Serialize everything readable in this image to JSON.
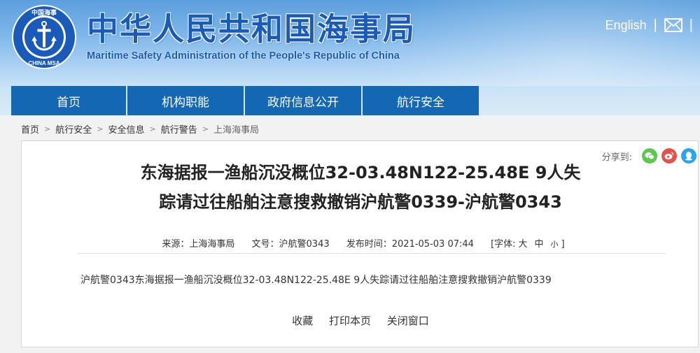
{
  "header": {
    "logo_text_top": "中国海事",
    "logo_text_bottom": "CHINA MSA",
    "title": "中华人民共和国海事局",
    "subtitle": "Maritime Safety Administration of the People's Republic of China",
    "english_link": "English",
    "separator": "|",
    "mail_icon": "mail-icon"
  },
  "nav": {
    "items": [
      {
        "label": "首页"
      },
      {
        "label": "机构职能"
      },
      {
        "label": "政府信息公开"
      },
      {
        "label": "航行安全"
      }
    ],
    "color": "#1467b3"
  },
  "breadcrumb": {
    "items": [
      "首页",
      "航行安全",
      "安全信息",
      "航行警告",
      "上海海事局"
    ],
    "separator": ">"
  },
  "share": {
    "label": "分享到:",
    "buttons": [
      {
        "name": "wechat-icon",
        "color": "#5cc84f"
      },
      {
        "name": "weibo-icon",
        "color": "#e2534d"
      },
      {
        "name": "qq-icon",
        "color": "#2ea4e8"
      }
    ]
  },
  "article": {
    "title_line1": "东海据报一渔船沉没概位32-03.48N122-25.48E 9人失",
    "title_line2": "踪请过往船舶注意搜救撤销沪航警0339-沪航警0343",
    "source": "来源：上海海事局",
    "doc_no": "文号：沪航警0343",
    "publish_time": "发布时间：2021-05-03 07:44",
    "font_label": "[字体:",
    "font_large": "大",
    "font_medium": "中",
    "font_small": "小",
    "font_close": "]",
    "body": "沪航警0343东海据报一渔船沉没概位32-03.48N122-25.48E 9人失踪请过往船舶注意搜救撤销沪航警0339"
  },
  "actions": {
    "favorite": "收藏",
    "print": "打印本页",
    "close": "关闭窗口"
  }
}
